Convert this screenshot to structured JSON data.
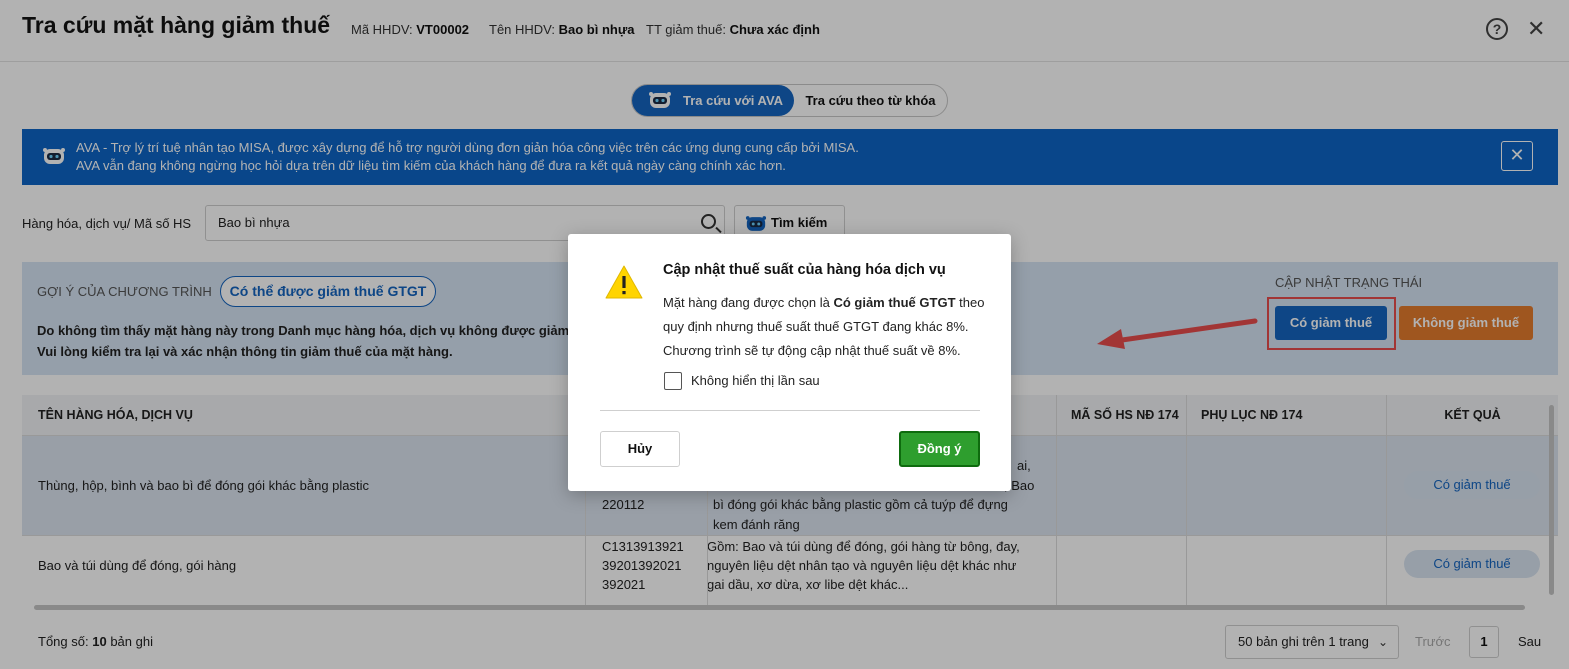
{
  "header": {
    "title": "Tra cứu mặt hàng giảm thuế",
    "invoice_code_label": "Mã HHDV:",
    "invoice_code": "VT00002",
    "invoice_name_label": "Tên HHDV:",
    "invoice_name": "Bao bì nhựa",
    "tax_status_label": "TT giảm thuế:",
    "tax_status": "Chưa xác định",
    "help_icon": "?",
    "close_icon": "✕"
  },
  "tabs": {
    "ava": "Tra cứu với AVA",
    "keyword": "Tra cứu theo từ khóa"
  },
  "banner": {
    "line1": "AVA - Trợ lý trí tuệ nhân tạo MISA, được xây dựng để hỗ trợ người dùng đơn giản hóa công việc trên các ứng dụng cung cấp bởi MISA.",
    "line2": "AVA vẫn đang không ngừng học hỏi dựa trên dữ liệu tìm kiếm của khách hàng để đưa ra kết quả ngày càng chính xác hơn.",
    "close_icon": "✕"
  },
  "search": {
    "label": "Hàng hóa, dịch vụ/ Mã số HS",
    "value": "Bao bì nhựa",
    "button": "Tìm kiếm"
  },
  "suggestion": {
    "caption": "GỢI Ý CỦA CHƯƠNG TRÌNH",
    "pill": "Có thể được giảm thuế GTGT",
    "text1": "Do không tìm thấy mặt hàng này trong Danh mục hàng hóa, dịch vụ không được giảm thuế G",
    "text2": "Vui lòng kiểm tra lại và xác nhận thông tin giảm thuế của mặt hàng.",
    "update_caption": "CẬP NHẬT TRẠNG THÁI",
    "btn_reduce": "Có giảm thuế",
    "btn_no_reduce": "Không giảm thuế"
  },
  "table": {
    "headers": {
      "name": "TÊN HÀNG HÓA, DỊCH VỤ",
      "hs_code": "MÃ SỐ HS NĐ 174",
      "appendix": "PHỤ LỤC NĐ 174",
      "result": "KẾT QUẢ"
    },
    "rows": [
      {
        "name": "Thùng, hộp, bình và bao bì để đóng gói khác bằng plastic",
        "codes_partial": "220112",
        "desc_partial1": "ai,",
        "desc_partial2": "; Bao",
        "desc_line3": "bì đóng gói khác bằng plastic gồm cả tuýp để đựng",
        "desc_line4": "kem đánh răng",
        "result": "Có giảm thuế"
      },
      {
        "name": "Bao và túi dùng để đóng, gói hàng",
        "code1": "C1313913921",
        "code2": "39201392021",
        "code3": "392021",
        "desc_line1": "Gồm: Bao và túi dùng để đóng, gói hàng từ bông, đay,",
        "desc_line2": "nguyên liệu dệt nhân tạo và nguyên liệu dệt khác như",
        "desc_line3": "gai dầu, xơ dừa, xơ libe dệt khác...",
        "result": "Có giảm thuế"
      }
    ]
  },
  "footer": {
    "total_label": "Tổng số:",
    "total_count": "10",
    "total_suffix": "bản ghi",
    "page_size": "50 bản ghi trên 1 trang",
    "prev": "Trước",
    "page": "1",
    "next": "Sau"
  },
  "dialog": {
    "title": "Cập nhật thuế suất của hàng hóa dịch vụ",
    "line1_pre": "Mặt hàng đang được chọn là ",
    "line1_bold": "Có giảm thuế GTGT",
    "line1_post": " theo",
    "line2": "quy định nhưng thuế suất thuế GTGT đang khác 8%.",
    "line3": "Chương trình sẽ tự động cập nhật thuế suất về 8%.",
    "checkbox_label": "Không hiển thị lần sau",
    "cancel": "Hủy",
    "confirm": "Đồng ý"
  },
  "colors": {
    "primary": "#1565c0",
    "banner": "#0d65c6",
    "orange": "#e47b2d",
    "green": "#2e9e2e",
    "highlight": "#e84c4c"
  }
}
